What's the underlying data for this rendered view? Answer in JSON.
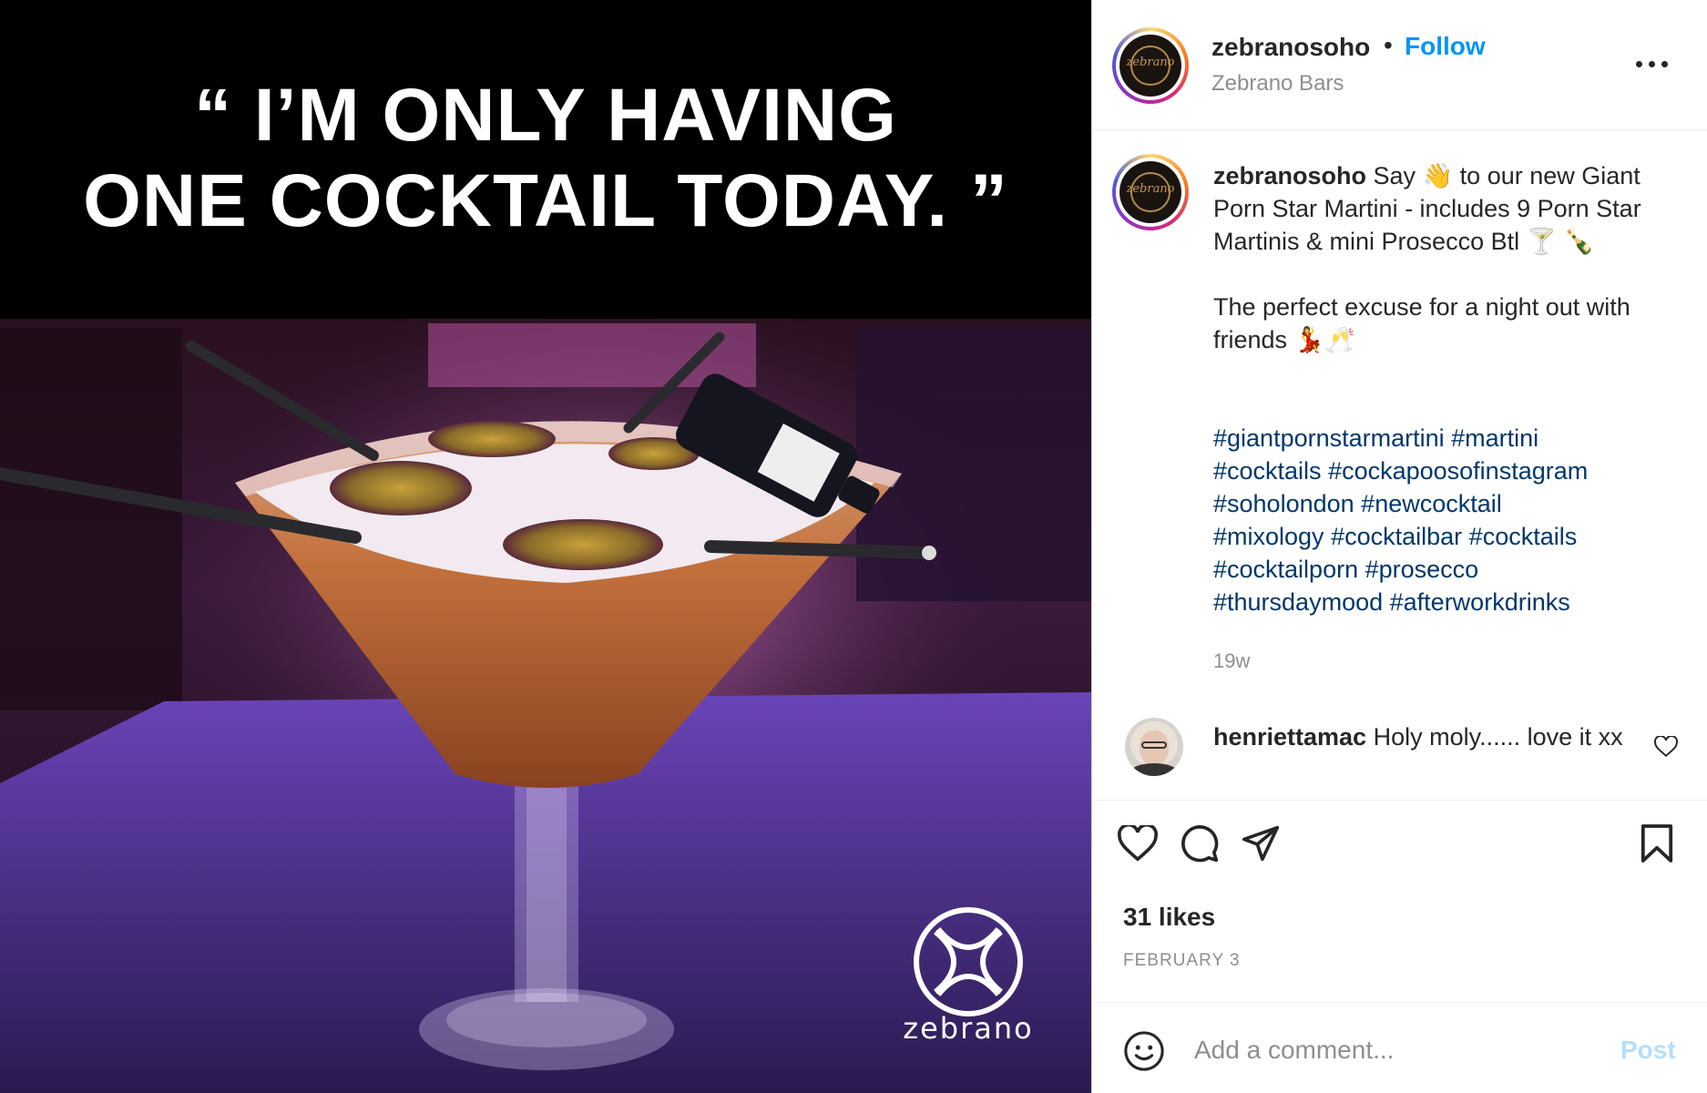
{
  "image": {
    "quote_line1": "“ I’M ONLY HAVING",
    "quote_line2": "ONE COCKTAIL TODAY. ”",
    "brand_word": "zebrano"
  },
  "header": {
    "username": "zebranosoho",
    "separator": "•",
    "follow_label": "Follow",
    "subtitle": "Zebrano Bars",
    "avatar_text": "zebrano"
  },
  "caption": {
    "username": "zebranosoho",
    "text": "Say 👋 to our new Giant Porn Star Martini - includes 9 Porn Star Martinis & mini Prosecco Btl 🍸 🍾\n\nThe perfect excuse for a night out with friends 💃🥂",
    "hashtags": [
      "#giantpornstarmartini",
      "#martini",
      "#cocktails",
      "#cockapoosofinstagram",
      "#soholondon",
      "#newcocktail",
      "#mixology",
      "#cocktailbar",
      "#cocktails",
      "#cocktailporn",
      "#prosecco",
      "#thursdaymood",
      "#afterworkdrinks"
    ],
    "age": "19w"
  },
  "comment": {
    "username": "henriettamac",
    "text": "Holy moly...... love it xx"
  },
  "actions": {
    "likes": "31 likes",
    "date": "FEBRUARY 3"
  },
  "add_comment": {
    "placeholder": "Add a comment...",
    "post_label": "Post"
  },
  "colors": {
    "follow": "#0095f6",
    "hashtag": "#00376b",
    "muted": "#8e8e8e",
    "post_disabled": "#b2dffc"
  }
}
